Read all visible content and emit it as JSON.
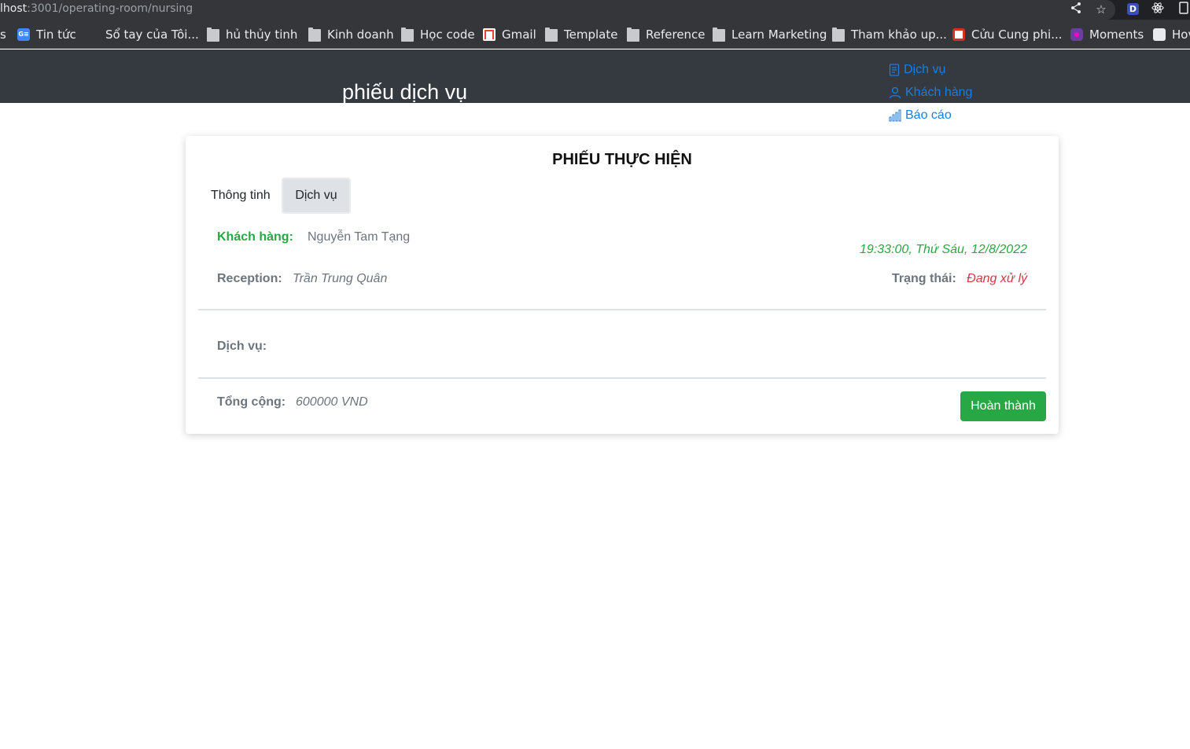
{
  "browser": {
    "url_host": "lhost",
    "url_path": ":3001/operating-room/nursing",
    "bookmarks": [
      {
        "label": "s",
        "icon": "none"
      },
      {
        "label": "Tin tức",
        "icon": "news-icon"
      },
      {
        "label": "Sổ tay của Tôi...",
        "icon": "microsoft-icon"
      },
      {
        "label": "hủ thủy tinh",
        "icon": "folder-icon"
      },
      {
        "label": "Kinh doanh",
        "icon": "folder-icon"
      },
      {
        "label": "Học code",
        "icon": "folder-icon"
      },
      {
        "label": "Gmail",
        "icon": "gmail-icon"
      },
      {
        "label": "Template",
        "icon": "folder-icon"
      },
      {
        "label": "Reference",
        "icon": "folder-icon"
      },
      {
        "label": "Learn Marketing",
        "icon": "folder-icon"
      },
      {
        "label": "Tham khảo up...",
        "icon": "folder-icon"
      },
      {
        "label": "Cửu Cung phi...",
        "icon": "cuu-cung-icon"
      },
      {
        "label": "Moments",
        "icon": "moments-icon"
      },
      {
        "label": "Hov",
        "icon": "how-icon"
      }
    ],
    "toolbar_icons": [
      "share-icon",
      "star-icon",
      "extension-d-icon",
      "react-icon",
      "sidepanel-icon"
    ],
    "extension_letter": "D"
  },
  "header": {
    "title": "phiếu dịch vụ",
    "bg_color": "#343a40"
  },
  "nav": {
    "items": [
      {
        "label": "Dịch vụ",
        "icon": "document-icon"
      },
      {
        "label": "Khách hàng",
        "icon": "user-icon"
      },
      {
        "label": "Báo cáo",
        "icon": "bar-chart-icon"
      }
    ],
    "link_color": "#1a7ee0"
  },
  "card": {
    "title": "PHIẾU THỰC HIỆN",
    "tabs": [
      {
        "label": "Thông tinh",
        "active": false
      },
      {
        "label": "Dịch vụ",
        "active": true
      }
    ],
    "customer_label": "Khách hàng:",
    "customer_name": "Nguyễn Tam Tạng",
    "datetime": "19:33:00, Thứ Sáu, 12/8/2022",
    "reception_label": "Reception:",
    "reception_name": "Trần Trung Quân",
    "status_label": "Trạng thái:",
    "status_value": "Đang xử lý",
    "services_label": "Dịch vụ:",
    "total_label": "Tổng cộng:",
    "total_value": "600000 VND",
    "done_button": "Hoàn thành"
  },
  "colors": {
    "success": "#28a745",
    "danger": "#dc3545",
    "muted": "#6c757d"
  }
}
